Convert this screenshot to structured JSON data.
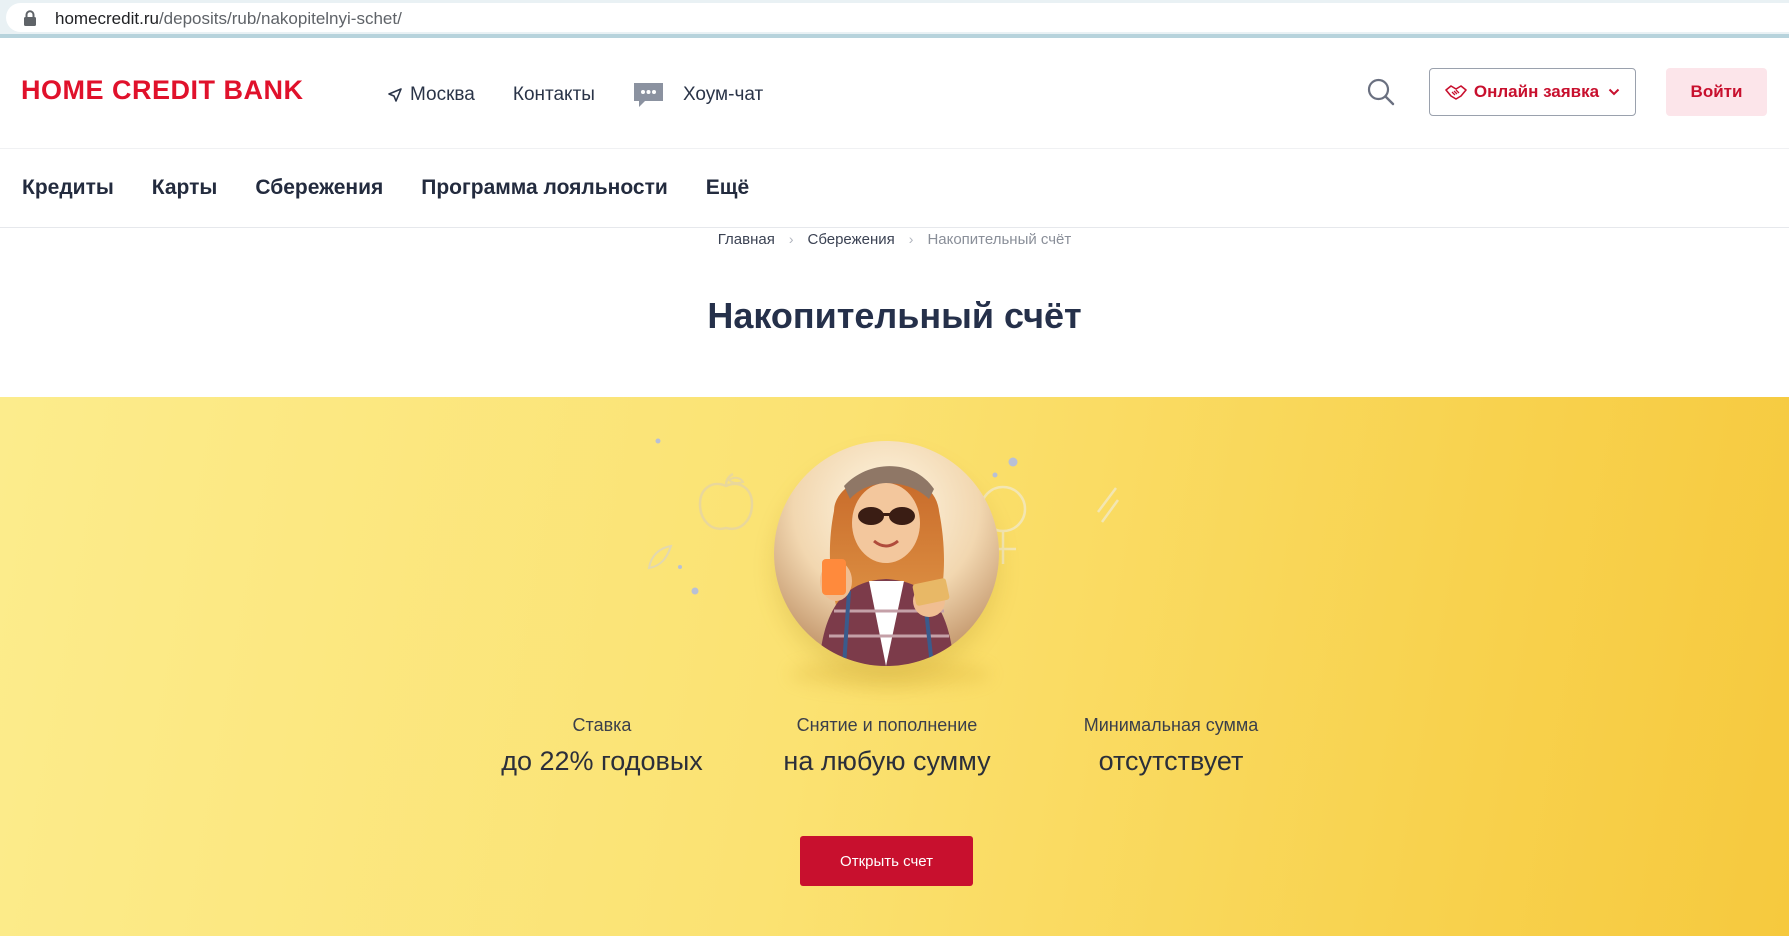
{
  "browser": {
    "url_host": "homecredit.ru",
    "url_path": "/deposits/rub/nakopitelnyi-schet/"
  },
  "header": {
    "logo_text": "HOME CREDIT BANK",
    "city": "Москва",
    "contacts": "Контакты",
    "chat": "Хоум-чат",
    "online_request": "Онлайн заявка",
    "login": "Войти"
  },
  "mainnav": {
    "items": [
      {
        "label": "Кредиты"
      },
      {
        "label": "Карты"
      },
      {
        "label": "Сбережения"
      },
      {
        "label": "Программа лояльности"
      },
      {
        "label": "Ещё"
      }
    ]
  },
  "breadcrumb": {
    "home": "Главная",
    "section": "Сбережения",
    "current": "Накопительный счёт"
  },
  "page": {
    "title": "Накопительный счёт"
  },
  "features": [
    {
      "label": "Ставка",
      "value": "до 22% годовых"
    },
    {
      "label": "Снятие и пополнение",
      "value": "на любую сумму"
    },
    {
      "label": "Минимальная сумма",
      "value": "отсутствует"
    }
  ],
  "hero": {
    "cta": "Открыть счет"
  },
  "colors": {
    "brand_red": "#e0112b",
    "button_red": "#c8102e",
    "hero_yellow_start": "#fcec8c",
    "hero_yellow_end": "#f6c93e"
  }
}
